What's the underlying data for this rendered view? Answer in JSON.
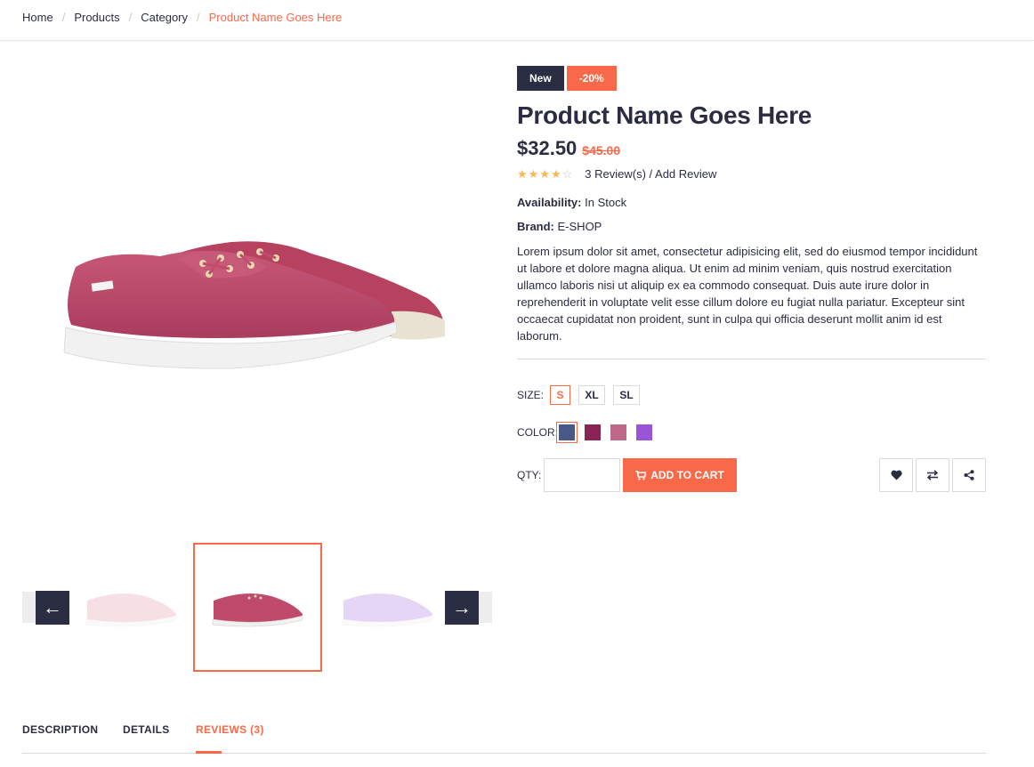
{
  "breadcrumb": {
    "items": [
      "Home",
      "Products",
      "Category"
    ],
    "current": "Product Name Goes Here"
  },
  "product": {
    "label_new": "New",
    "label_sale": "-20%",
    "title": "Product Name Goes Here",
    "price": "$32.50",
    "old_price": "$45.00",
    "rating": 4,
    "rating_max": 5,
    "review_text": "3 Review(s) / Add Review",
    "availability_label": "Availability:",
    "availability_value": "In Stock",
    "brand_label": "Brand:",
    "brand_value": "E-SHOP",
    "description": "Lorem ipsum dolor sit amet, consectetur adipisicing elit, sed do eiusmod tempor incididunt ut labore et dolore magna aliqua. Ut enim ad minim veniam, quis nostrud exercitation ullamco laboris nisi ut aliquip ex ea commodo consequat. Duis aute irure dolor in reprehenderit in voluptate velit esse cillum dolore eu fugiat nulla pariatur. Excepteur sint occaecat cupidatat non proident, sunt in culpa qui officia deserunt mollit anim id est laborum."
  },
  "options": {
    "size_label": "SIZE:",
    "sizes": [
      "S",
      "XL",
      "SL"
    ],
    "selected_size": "S",
    "color_label": "COLOR:",
    "colors": [
      "#475984",
      "#8A2454",
      "#BF6989",
      "#9A54D8"
    ],
    "selected_color_index": 0,
    "qty_label": "QTY:",
    "qty_value": "",
    "add_to_cart": "ADD TO CART"
  },
  "actions": {
    "wishlist_icon": "heart-icon",
    "compare_icon": "exchange-icon",
    "share_icon": "share-icon"
  },
  "gallery": {
    "prev_icon": "arrow-left-icon",
    "next_icon": "arrow-right-icon",
    "shoe_color": "#C04A6C",
    "thumb_colors": [
      "#E8A7B8",
      "#C04A6C",
      "#D8B4F2"
    ],
    "selected_thumb_index": 1
  },
  "tabs": {
    "items": [
      "DESCRIPTION",
      "DETAILS",
      "REVIEWS (3)"
    ],
    "active_index": 2
  },
  "colors": {
    "primary": "#F8694A",
    "dark": "#2B2D42",
    "star": "#FFB656"
  }
}
